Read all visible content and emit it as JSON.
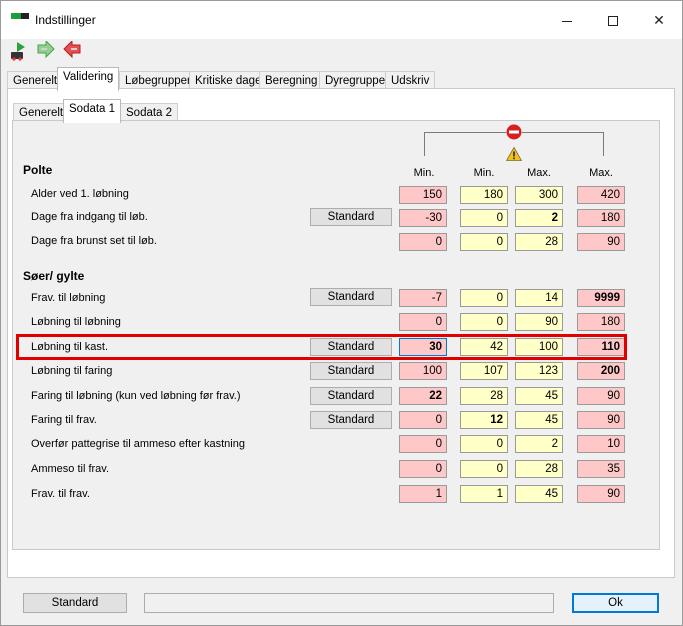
{
  "window": {
    "title": "Indstillinger"
  },
  "tabs": [
    "Generelt",
    "Validering",
    "Løbegrupper",
    "Kritiske dage",
    "Beregning",
    "Dyregruppe",
    "Udskriv"
  ],
  "subtabs": [
    "Generelt",
    "Sodata 1",
    "Sodata 2"
  ],
  "column_headers": {
    "min_red": "Min.",
    "min_yellow": "Min.",
    "max_yellow": "Max.",
    "max_red": "Max."
  },
  "sections": {
    "polte": "Polte",
    "soer": "Søer/ gylte"
  },
  "standard_label": "Standard",
  "rows": [
    {
      "label": "Alder ved 1. løbning",
      "v": [
        "150",
        "180",
        "300",
        "420"
      ]
    },
    {
      "label": "Dage fra indgang til løb.",
      "v": [
        "-30",
        "0",
        "2",
        "180"
      ]
    },
    {
      "label": "Dage fra brunst set til løb.",
      "v": [
        "0",
        "0",
        "28",
        "90"
      ]
    },
    {
      "label": "Frav. til løbning",
      "v": [
        "-7",
        "0",
        "14",
        "9999"
      ]
    },
    {
      "label": "Løbning til løbning",
      "v": [
        "0",
        "0",
        "90",
        "180"
      ]
    },
    {
      "label": "Løbning til kast.",
      "v": [
        "30",
        "42",
        "100",
        "110"
      ]
    },
    {
      "label": "Løbning til faring",
      "v": [
        "100",
        "107",
        "123",
        "200"
      ]
    },
    {
      "label": "Faring til løbning (kun ved løbning før frav.)",
      "v": [
        "22",
        "28",
        "45",
        "90"
      ]
    },
    {
      "label": "Faring til frav.",
      "v": [
        "0",
        "12",
        "45",
        "90"
      ]
    },
    {
      "label": "Overfør pattegrise til ammeso efter kastning",
      "v": [
        "0",
        "0",
        "2",
        "10"
      ]
    },
    {
      "label": "Ammeso til frav.",
      "v": [
        "0",
        "0",
        "28",
        "35"
      ]
    },
    {
      "label": "Frav. til frav.",
      "v": [
        "1",
        "1",
        "45",
        "90"
      ]
    }
  ],
  "footer": {
    "standard_label": "Standard",
    "ok_label": "Ok"
  },
  "colors": {
    "error_field": "#ffc8c8",
    "warning_field": "#ffffc8",
    "highlight": "#e00000",
    "accent": "#0078d7"
  },
  "icons": [
    "app-icon",
    "save-icon",
    "forward-icon",
    "back-icon",
    "error-icon",
    "warning-icon"
  ]
}
